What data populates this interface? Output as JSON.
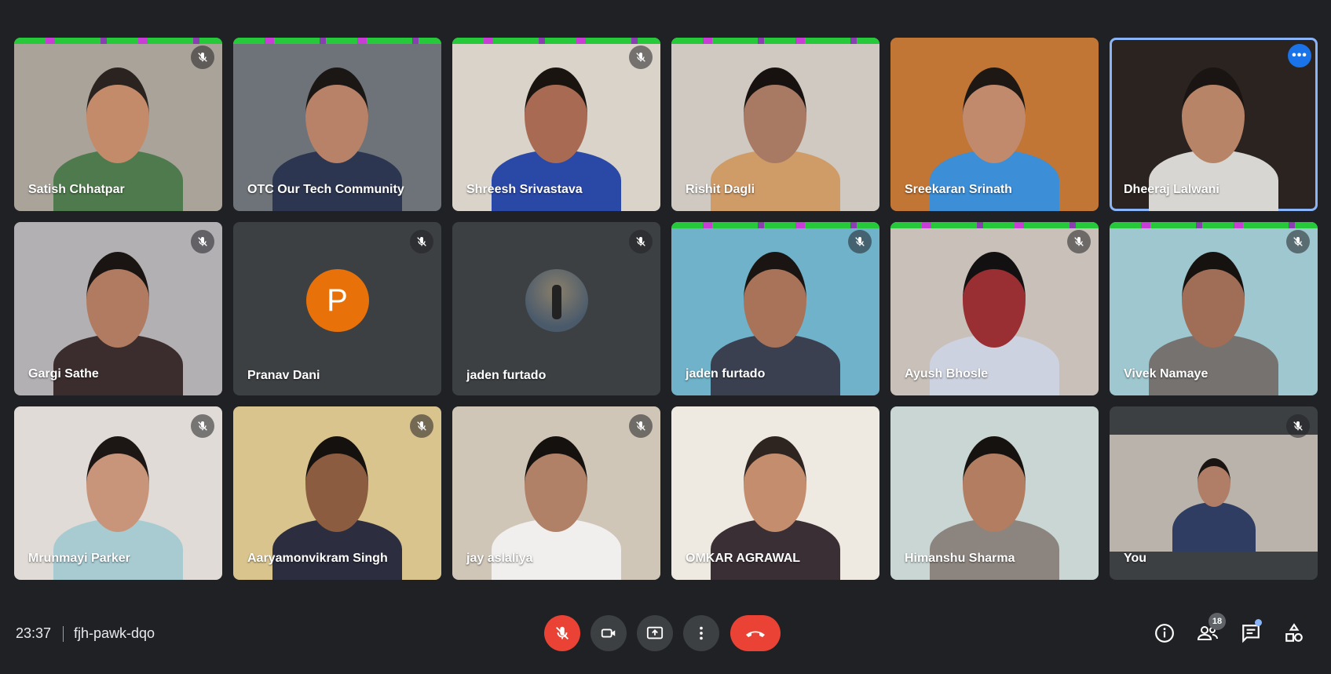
{
  "participants": [
    {
      "name": "Satish Chhatpar",
      "muted": true,
      "bg": "#a9a39a",
      "skin": "#c48b6a",
      "shirt": "#4f7a4d",
      "hair": "#2a2320",
      "strip": true
    },
    {
      "name": "OTC Our Tech Community",
      "muted": false,
      "bg": "#6d7378",
      "skin": "#b78268",
      "shirt": "#2d3650",
      "hair": "#1b1714",
      "strip": true
    },
    {
      "name": "Shreesh Srivastava",
      "muted": true,
      "bg": "#d9d3ca",
      "skin": "#a86a52",
      "shirt": "#2a48a6",
      "hair": "#1a1410",
      "strip": true
    },
    {
      "name": "Rishit Dagli",
      "muted": false,
      "bg": "#cfc9c2",
      "skin": "#a87a63",
      "shirt": "#cf9b67",
      "hair": "#17120f",
      "strip": true
    },
    {
      "name": "Sreekaran Srinath",
      "muted": false,
      "bg": "#c17635",
      "skin": "#c28a6c",
      "shirt": "#3c8ed6",
      "hair": "#1d1814",
      "strip": false
    },
    {
      "name": "Dheeraj Lalwani",
      "muted": false,
      "bg": "#2b2320",
      "skin": "#b88468",
      "shirt": "#d8d6d2",
      "hair": "#1a1512",
      "strip": false,
      "pinned": true
    },
    {
      "name": "Gargi Sathe",
      "muted": true,
      "bg": "#b3b0b4",
      "skin": "#b07b60",
      "shirt": "#3b2d2d",
      "hair": "#1a1412",
      "strip": false
    },
    {
      "name": "Pranav Dani",
      "muted": true,
      "avatar": "P",
      "strip": false
    },
    {
      "name": "jaden furtado",
      "muted": true,
      "avatar_photo": true,
      "strip": false
    },
    {
      "name": "jaden furtado",
      "muted": true,
      "bg": "#6fb2c9",
      "skin": "#a9735a",
      "shirt": "#3a4050",
      "hair": "#1a1512",
      "strip": true
    },
    {
      "name": "Ayush Bhosle",
      "muted": true,
      "bg": "#c9c1b9",
      "skin": "#9a2f33",
      "shirt": "#cdd2e0",
      "hair": "#121010",
      "strip": true
    },
    {
      "name": "Vivek Namaye",
      "muted": true,
      "bg": "#9ec7cf",
      "skin": "#a06e56",
      "shirt": "#767270",
      "hair": "#161210",
      "strip": true
    },
    {
      "name": "Mrunmayi Parker",
      "muted": true,
      "bg": "#e0dbd6",
      "skin": "#c8957b",
      "shirt": "#a8cbd2",
      "hair": "#1c1615",
      "strip": false
    },
    {
      "name": "Aaryamonvikram Singh",
      "muted": true,
      "bg": "#d9c48e",
      "skin": "#8c5c40",
      "shirt": "#2c2d3e",
      "hair": "#15110e",
      "strip": false
    },
    {
      "name": "jay aslaliya",
      "muted": true,
      "bg": "#cfc6b8",
      "skin": "#b08067",
      "shirt": "#f0efed",
      "hair": "#15110e",
      "strip": false
    },
    {
      "name": "OMKAR AGRAWAL",
      "muted": false,
      "bg": "#eeeae1",
      "skin": "#c48d6e",
      "shirt": "#3a2f35",
      "hair": "#2e2420",
      "strip": false
    },
    {
      "name": "Himanshu Sharma",
      "muted": false,
      "bg": "#c9d6d3",
      "skin": "#b27d60",
      "shirt": "#8c847e",
      "hair": "#16120f",
      "strip": false
    },
    {
      "name": "You",
      "muted": true,
      "bg": "#b9b3ab",
      "skin": "#b07e66",
      "shirt": "#2f3d63",
      "hair": "#1a1512",
      "strip": false,
      "self": true
    }
  ],
  "footer": {
    "time": "23:37",
    "meeting_code": "fjh-pawk-dqo",
    "people_count": "18"
  },
  "icons": {
    "mic": "mic-off-icon",
    "camera": "camera-icon",
    "present": "present-screen-icon",
    "more": "more-vert-icon",
    "hangup": "call-end-icon",
    "info": "info-icon",
    "people": "people-icon",
    "chat": "chat-icon",
    "activities": "activities-icon"
  },
  "colors": {
    "background": "#202124",
    "tile": "#3c4043",
    "hangup": "#ea4335",
    "accent": "#8ab4f8",
    "avatar_orange": "#e8710a"
  }
}
